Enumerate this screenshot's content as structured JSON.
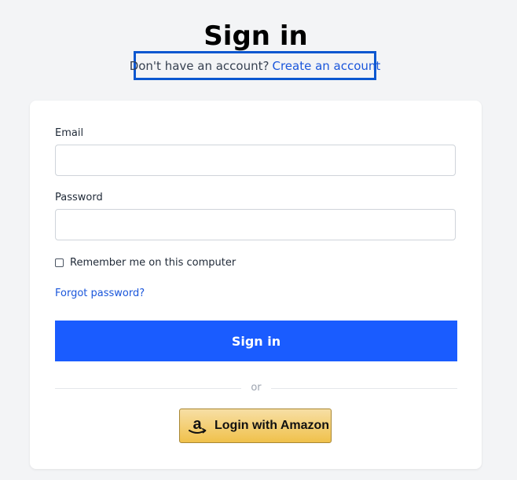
{
  "header": {
    "title": "Sign in",
    "signup_prompt": "Don't have an account?",
    "signup_link": "Create an account"
  },
  "form": {
    "email_label": "Email",
    "email_value": "",
    "password_label": "Password",
    "password_value": "",
    "remember_label": "Remember me on this computer",
    "remember_checked": false,
    "forgot_label": "Forgot password?",
    "submit_label": "Sign in",
    "divider_label": "or",
    "amazon_label": "Login with Amazon"
  },
  "colors": {
    "primary": "#1a5cff",
    "link": "#1a56db",
    "highlight_border": "#0b57d0",
    "amazon_button": "#f0c14b"
  },
  "icons": {
    "amazon_logo": "amazon-logo-icon"
  }
}
